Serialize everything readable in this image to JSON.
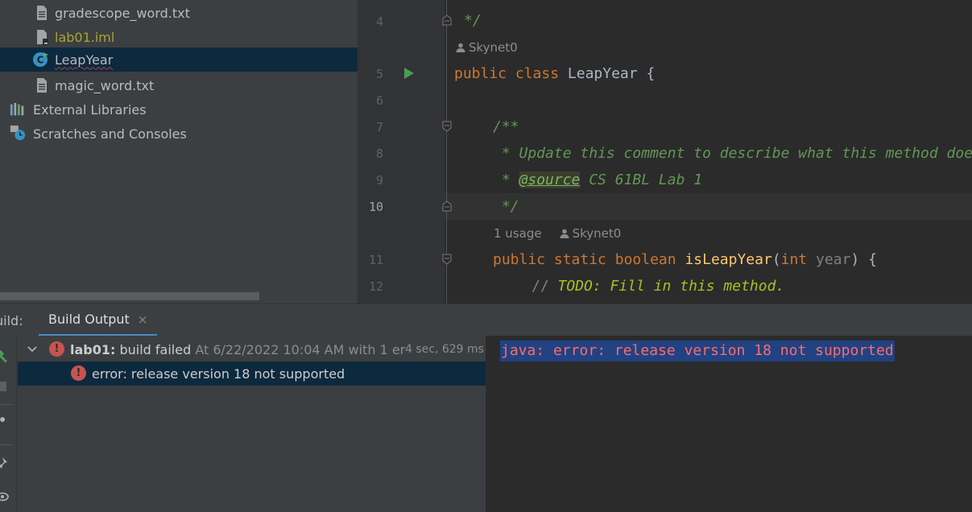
{
  "project_tree": {
    "items": [
      {
        "label": "gradescope_word.txt",
        "icon": "text-file-icon"
      },
      {
        "label": "lab01.iml",
        "icon": "module-file-icon"
      },
      {
        "label": "LeapYear",
        "icon": "java-class-icon",
        "selected": true
      },
      {
        "label": "magic_word.txt",
        "icon": "text-file-icon"
      },
      {
        "label": "External Libraries",
        "icon": "libraries-icon"
      },
      {
        "label": "Scratches and Consoles",
        "icon": "scratches-icon"
      }
    ]
  },
  "editor": {
    "line_numbers": [
      "4",
      "5",
      "6",
      "7",
      "8",
      "9",
      "10",
      "11",
      "12"
    ],
    "current_line": "10",
    "author_hint": "Skynet0",
    "usage_hint": "1 usage",
    "code": {
      "l4": "*/",
      "l5_kw1": "public",
      "l5_kw2": "class",
      "l5_name": "LeapYear {",
      "l7": "/**",
      "l8": " * Update this comment to describe what this method does.",
      "l9_star": " * ",
      "l9_tag": "@source",
      "l9_rest": " CS 61BL Lab 1",
      "l10": " */",
      "l11_kw1": "public",
      "l11_kw2": "static",
      "l11_kw3": "boolean",
      "l11_fn": "isLeapYear",
      "l11_open": "(",
      "l11_type": "int",
      "l11_param": "year",
      "l11_close": ") {",
      "l12_comment": "// ",
      "l12_todo": "TODO: Fill in this method."
    }
  },
  "build": {
    "label": "uild:",
    "tab_label": "Build Output",
    "tab_close": "×",
    "tree": {
      "root_name": "lab01:",
      "root_status": " build failed",
      "root_time": " At 6/22/2022 10:04 AM with 1 er",
      "root_duration": "4 sec, 629 ms",
      "error_message": "error: release version 18 not supported"
    },
    "console_line": "java: error: release version 18 not supported"
  },
  "colors": {
    "accent": "#4a88c7",
    "error": "#c75450",
    "run": "#499c54",
    "selection": "#0d293e"
  }
}
